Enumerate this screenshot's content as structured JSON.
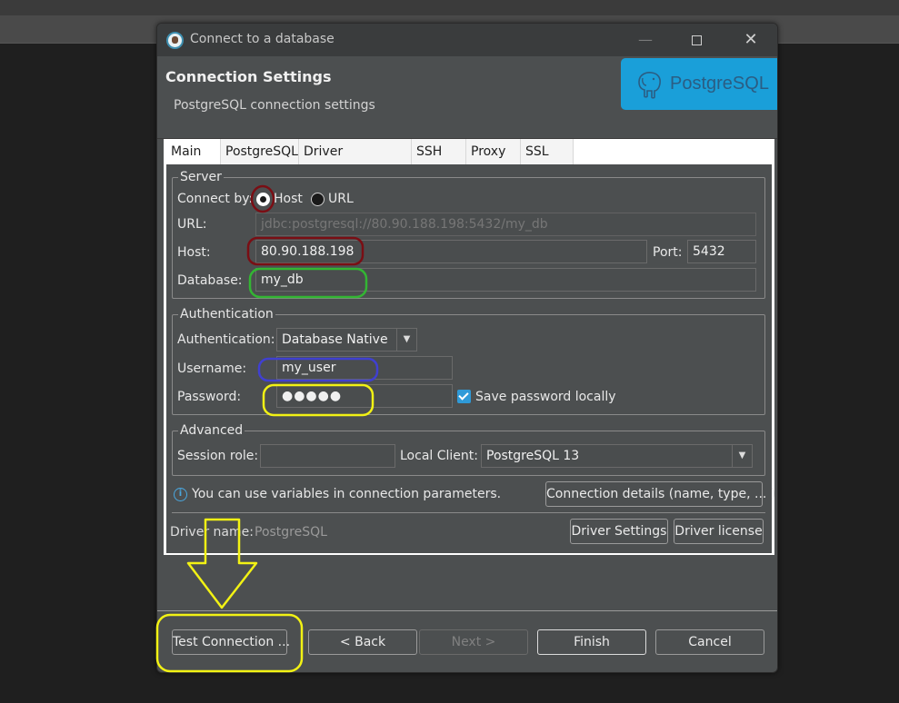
{
  "window": {
    "title": "Connect to a database"
  },
  "header": {
    "title": "Connection Settings",
    "subtitle": "PostgreSQL connection settings",
    "logo_text": "PostgreSQL"
  },
  "tabs": [
    {
      "label": "Main",
      "active": true
    },
    {
      "label": "PostgreSQL"
    },
    {
      "label": "Driver properties"
    },
    {
      "label": "SSH"
    },
    {
      "label": "Proxy"
    },
    {
      "label": "SSL"
    }
  ],
  "server": {
    "group_title": "Server",
    "connect_by_label": "Connect by:",
    "host_option": "Host",
    "url_option": "URL",
    "connect_by_selected": "Host",
    "url_label": "URL:",
    "url_value": "jdbc:postgresql://80.90.188.198:5432/my_db",
    "host_label": "Host:",
    "host_value": "80.90.188.198",
    "port_label": "Port:",
    "port_value": "5432",
    "database_label": "Database:",
    "database_value": "my_db"
  },
  "authentication": {
    "group_title": "Authentication",
    "auth_label": "Authentication:",
    "auth_value": "Database Native",
    "username_label": "Username:",
    "username_value": "my_user",
    "password_label": "Password:",
    "password_value": "●●●●●",
    "save_password_label": "Save password locally",
    "save_password_checked": true
  },
  "advanced": {
    "group_title": "Advanced",
    "session_role_label": "Session role:",
    "session_role_value": "",
    "local_client_label": "Local Client:",
    "local_client_value": "PostgreSQL 13"
  },
  "info": {
    "text": "You can use variables in connection parameters.",
    "details_button": "Connection details (name, type, ... )"
  },
  "driver": {
    "label": "Driver name:",
    "value": "PostgreSQL",
    "settings_button": "Driver Settings",
    "license_button": "Driver license"
  },
  "footer": {
    "test_button": "Test Connection ...",
    "back_button": "< Back",
    "next_button": "Next >",
    "finish_button": "Finish",
    "cancel_button": "Cancel"
  },
  "colors": {
    "annotation_dark_red": "#7a0e14",
    "annotation_green": "#33b533",
    "annotation_blue": "#4040d0",
    "annotation_yellow": "#f2f214",
    "brand_blue": "#1a9fd9",
    "checkbox_blue": "#2f9ad8"
  }
}
